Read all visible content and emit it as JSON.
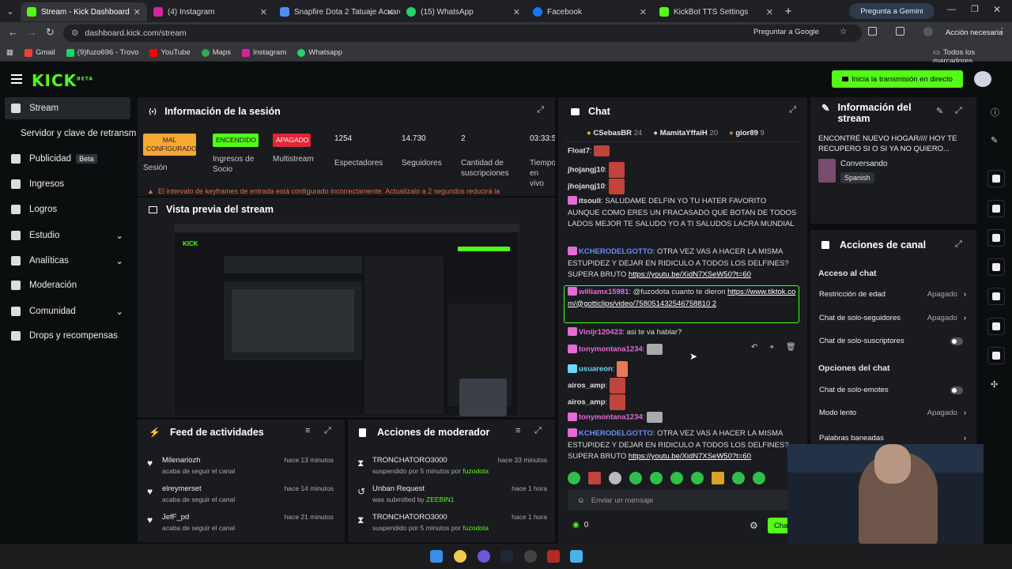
{
  "browser": {
    "tabs": [
      {
        "label": "Stream - Kick Dashboard",
        "color": "#53fc18",
        "active": true
      },
      {
        "label": "(4) Instagram",
        "color": "#d6249f"
      },
      {
        "label": "Snapfire Dota 2 Tatuaje Acuarel",
        "color": "#4f8ef7"
      },
      {
        "label": "(15) WhatsApp",
        "color": "#25d366"
      },
      {
        "label": "Facebook",
        "color": "#1877f2"
      },
      {
        "label": "KickBot TTS Settings",
        "color": "#53fc18"
      }
    ],
    "gemini": "Pregunta a Gemini",
    "url": "dashboard.kick.com/stream",
    "translate": "Preguntar a Google",
    "action": "Acción necesaria",
    "bookmarks": [
      "Gmail",
      "(9)fuzo696 - Trovo",
      "YouTube",
      "Maps",
      "Instagram",
      "Whatsapp"
    ],
    "all_bookmarks": "Todos los marcadores"
  },
  "header": {
    "logo": "KICK",
    "beta": "BETA",
    "go_live": "Inicia la transmisión en directo"
  },
  "sidebar": {
    "items": [
      "Stream",
      "Servidor y clave de retransm",
      "Publicidad",
      "Ingresos",
      "Logros",
      "Estudio",
      "Analíticas",
      "Moderación",
      "Comunidad",
      "Drops y recompensas"
    ],
    "beta": "Beta"
  },
  "session": {
    "title": "Información de la sesión",
    "badges": [
      "MAL CONFIGURADO",
      "ENCENDIDO",
      "APAGADO"
    ],
    "labels": [
      "Sesión",
      "Ingresos de Socio",
      "Multistream"
    ],
    "stats": [
      {
        "v": "1254",
        "l": "Espectadores"
      },
      {
        "v": "14.730",
        "l": "Seguidores"
      },
      {
        "v": "2",
        "l": "Cantidad de suscripciones"
      },
      {
        "v": "03:33:5",
        "l": "Tiempo en vivo"
      }
    ],
    "warning": "El intervalo de keyframes de entrada está configurado incorrectamente. Actualízalo a 2 segundos reducirá la"
  },
  "preview": {
    "title": "Vista previa del stream"
  },
  "feed": {
    "title": "Feed de actividades",
    "rows": [
      {
        "name": "Milenariozh",
        "sub": "acaba de seguir el canal",
        "time": "hace 13 minutos"
      },
      {
        "name": "elreymerset",
        "sub": "acaba de seguir el canal",
        "time": "hace 14 minutos"
      },
      {
        "name": "JefF_pd",
        "sub": "acaba de seguir el canal",
        "time": "hace 21 minutos"
      }
    ]
  },
  "mod": {
    "title": "Acciones de moderador",
    "rows": [
      {
        "name": "TRONCHATORO3000",
        "sub": "suspendido por 5 minutos por",
        "by": "fuzodota",
        "time": "hace 33 minutos"
      },
      {
        "name": "Unban Request",
        "sub": "was submitted by",
        "by": "ZEEBIN1",
        "time": "hace 1 hora"
      },
      {
        "name": "TRONCHATORO3000",
        "sub": "suspendido por 5 minutos por",
        "by": "fuzodota",
        "time": "hace 1 hora"
      }
    ]
  },
  "chat": {
    "title": "Chat",
    "top": [
      {
        "name": "CSebasBR",
        "n": "24"
      },
      {
        "name": "MamitaYffaiH",
        "n": "20"
      },
      {
        "name": "gior89",
        "n": "9"
      }
    ],
    "messages": [
      {
        "user": "Float7",
        "color": "#eee",
        "text": ":"
      },
      {
        "user": "jhojangj10",
        "color": "#eee",
        "text": ":"
      },
      {
        "user": "jhojangj10",
        "color": "#eee",
        "text": ":"
      },
      {
        "user": "itsoull",
        "color": "#eee",
        "text": ": SALUDAME DELFIN YO TU HATER FAVORITO AUNQUE COMO ERES UN FRACASADO QUE BOTAN DE TODOS LADOS MEJOR TE SALUDO YO A TI SALUDOS LACRA MUNDIAL"
      },
      {
        "user": "KCHERODELGOTTO",
        "color": "#6a8cff",
        "text": ": OTRA VEZ VAS A HACER LA MISMA ESTUPIDEZ Y DEJAR EN RIDICULO A TODOS LOS DELFINES? SUPERA BRUTO ",
        "link": "https://youtu.be/XidN7XSeW50?t=60"
      },
      {
        "user": "williamx15981",
        "color": "#e56bd6",
        "text": ": @fuzodota cuanto te dieron ",
        "link": "https://www.tiktok.com/@gotticlips/video/758051432546758810 2"
      },
      {
        "user": "Vinijr120423",
        "color": "#e56bd6",
        "text": ": asi te va hablar?"
      },
      {
        "user": "tonymontana1234",
        "color": "#e56bd6",
        "text": ":"
      },
      {
        "user": "usuareon",
        "color": "#6ad8ff",
        "text": ":"
      },
      {
        "user": "airos_amp",
        "color": "#eee",
        "text": ":"
      },
      {
        "user": "airos_amp",
        "color": "#eee",
        "text": ":"
      },
      {
        "user": "tonymontana1234",
        "color": "#e56bd6",
        "text": ":"
      },
      {
        "user": "KCHERODELGOTTO",
        "color": "#6a8cff",
        "text": ": OTRA VEZ VAS A HACER LA MISMA ESTUPIDEZ Y DEJAR EN RIDICULO A TODOS LOS DELFINES? SUPERA BRUTO ",
        "link": "https://youtu.be/XidN7XSeW50?t=60"
      }
    ],
    "placeholder": "Enviar un mensaje",
    "points": "0",
    "send": "Cha"
  },
  "info": {
    "title": "Información del stream",
    "stream_title": "ENCONTRÉ NUEVO HOGAR//// HOY TE RECUPERO SI O SI YA NO QUIERO...",
    "category": "Conversando",
    "language": "Spanish"
  },
  "actions": {
    "title": "Acciones de canal",
    "access": "Acceso al chat",
    "options": "Opciones del chat",
    "rows": [
      {
        "l": "Restricción de edad",
        "v": "Apagado"
      },
      {
        "l": "Chat de solo-seguidores",
        "v": "Apagado"
      },
      {
        "l": "Chat de solo-suscriptores",
        "v": ""
      },
      {
        "l": "Chat de solo-emotes",
        "v": ""
      },
      {
        "l": "Modo lento",
        "v": "Apagado"
      },
      {
        "l": "Palabras baneadas",
        "v": ""
      }
    ]
  }
}
